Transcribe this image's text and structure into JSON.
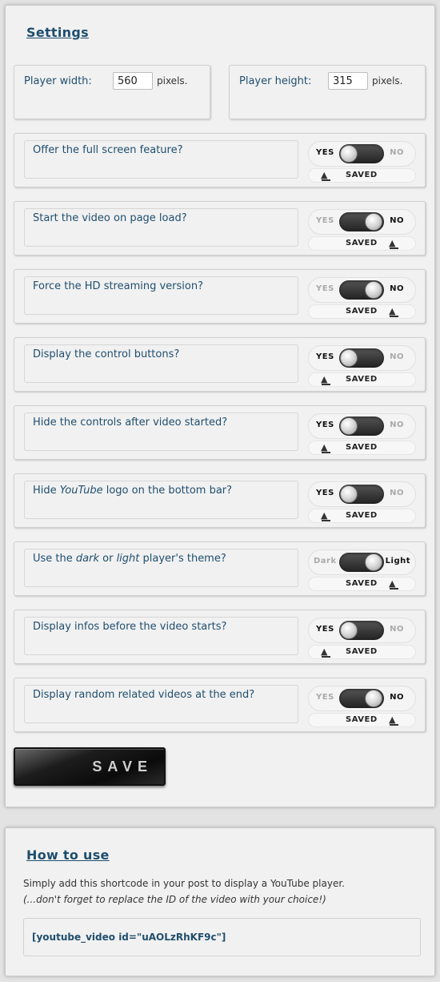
{
  "settings": {
    "title": "Settings",
    "player_width": {
      "label": "Player width:",
      "value": "560",
      "unit": "pixels."
    },
    "player_height": {
      "label": "Player height:",
      "value": "315",
      "unit": "pixels."
    },
    "options": [
      {
        "question": "Offer the full screen feature?",
        "left": "YES",
        "right": "NO",
        "selected": "left",
        "saved": "SAVED"
      },
      {
        "question": "Start the video on page load?",
        "left": "YES",
        "right": "NO",
        "selected": "right",
        "saved": "SAVED"
      },
      {
        "question": "Force the HD streaming version?",
        "left": "YES",
        "right": "NO",
        "selected": "right",
        "saved": "SAVED"
      },
      {
        "question": "Display the control buttons?",
        "left": "YES",
        "right": "NO",
        "selected": "left",
        "saved": "SAVED"
      },
      {
        "question": "Hide the controls after video started?",
        "left": "YES",
        "right": "NO",
        "selected": "left",
        "saved": "SAVED"
      },
      {
        "question_pre": "Hide ",
        "question_em": "YouTube",
        "question_post": " logo on the bottom bar?",
        "left": "YES",
        "right": "NO",
        "selected": "left",
        "saved": "SAVED"
      },
      {
        "question_pre": "Use the ",
        "question_em": "dark",
        "question_mid": " or ",
        "question_em2": "light",
        "question_post": " player's theme?",
        "left": "Dark",
        "right": "Light",
        "selected": "right",
        "saved": "SAVED"
      },
      {
        "question": "Display infos before the video starts?",
        "left": "YES",
        "right": "NO",
        "selected": "left",
        "saved": "SAVED"
      },
      {
        "question": "Display random related videos at the end?",
        "left": "YES",
        "right": "NO",
        "selected": "right",
        "saved": "SAVED"
      }
    ],
    "save_label": "SAVE"
  },
  "howto": {
    "title": "How to use",
    "description": "Simply add this shortcode in your post to display a YouTube player.",
    "note": "(...don't forget to replace the ID of the video with your choice!)",
    "shortcode": "[youtube_video id=\"uAOLzRhKF9c\"]"
  }
}
